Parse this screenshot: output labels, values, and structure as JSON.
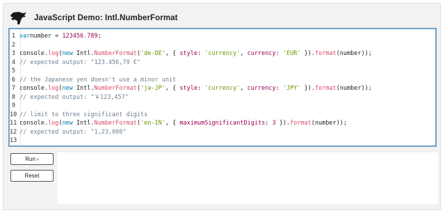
{
  "header": {
    "title": "JavaScript Demo: Intl.NumberFormat",
    "logo_icon": "dinosaur-logo-icon"
  },
  "editor": {
    "lines": [
      {
        "num": "1",
        "tokens": [
          [
            "kw",
            "var"
          ],
          [
            "",
            "number = "
          ],
          [
            "num",
            "123456.789"
          ],
          [
            "",
            ";"
          ]
        ]
      },
      {
        "num": "2",
        "tokens": []
      },
      {
        "num": "3",
        "tokens": [
          [
            "",
            "console."
          ],
          [
            "fn",
            "log"
          ],
          [
            "",
            "("
          ],
          [
            "kw",
            "new"
          ],
          [
            "",
            " Intl."
          ],
          [
            "fn",
            "NumberFormat"
          ],
          [
            "",
            "("
          ],
          [
            "str",
            "'de-DE'"
          ],
          [
            "",
            ", { "
          ],
          [
            "prop",
            "style"
          ],
          [
            "",
            ": "
          ],
          [
            "str",
            "'currency'"
          ],
          [
            "",
            ", "
          ],
          [
            "prop",
            "currency"
          ],
          [
            "",
            ": "
          ],
          [
            "str",
            "'EUR'"
          ],
          [
            "",
            " })."
          ],
          [
            "fn",
            "format"
          ],
          [
            "",
            "(number));"
          ]
        ]
      },
      {
        "num": "4",
        "tokens": [
          [
            "cmt",
            "// expected output: \"123.456,79 €\""
          ]
        ]
      },
      {
        "num": "5",
        "tokens": []
      },
      {
        "num": "6",
        "tokens": [
          [
            "cmt",
            "// the Japanese yen doesn't use a minor unit"
          ]
        ]
      },
      {
        "num": "7",
        "tokens": [
          [
            "",
            "console."
          ],
          [
            "fn",
            "log"
          ],
          [
            "",
            "("
          ],
          [
            "kw",
            "new"
          ],
          [
            "",
            " Intl."
          ],
          [
            "fn",
            "NumberFormat"
          ],
          [
            "",
            "("
          ],
          [
            "str",
            "'ja-JP'"
          ],
          [
            "",
            ", { "
          ],
          [
            "prop",
            "style"
          ],
          [
            "",
            ": "
          ],
          [
            "str",
            "'currency'"
          ],
          [
            "",
            ", "
          ],
          [
            "prop",
            "currency"
          ],
          [
            "",
            ": "
          ],
          [
            "str",
            "'JPY'"
          ],
          [
            "",
            " })."
          ],
          [
            "fn",
            "format"
          ],
          [
            "",
            "(number));"
          ]
        ]
      },
      {
        "num": "8",
        "tokens": [
          [
            "cmt",
            "// expected output: \"￥123,457\""
          ]
        ]
      },
      {
        "num": "9",
        "tokens": []
      },
      {
        "num": "10",
        "tokens": [
          [
            "cmt",
            "// limit to three significant digits"
          ]
        ]
      },
      {
        "num": "11",
        "tokens": [
          [
            "",
            "console."
          ],
          [
            "fn",
            "log"
          ],
          [
            "",
            "("
          ],
          [
            "kw",
            "new"
          ],
          [
            "",
            " Intl."
          ],
          [
            "fn",
            "NumberFormat"
          ],
          [
            "",
            "("
          ],
          [
            "str",
            "'en-IN'"
          ],
          [
            "",
            ", { "
          ],
          [
            "prop",
            "maximumSignificantDigits"
          ],
          [
            "",
            ": "
          ],
          [
            "num",
            "3"
          ],
          [
            "",
            " })."
          ],
          [
            "fn",
            "format"
          ],
          [
            "",
            "(number));"
          ]
        ]
      },
      {
        "num": "12",
        "tokens": [
          [
            "cmt",
            "// expected output: \"1,23,000\""
          ]
        ]
      },
      {
        "num": "13",
        "tokens": []
      }
    ]
  },
  "buttons": {
    "run_label": "Run ›",
    "reset_label": "Reset"
  },
  "output": {
    "text": ""
  }
}
